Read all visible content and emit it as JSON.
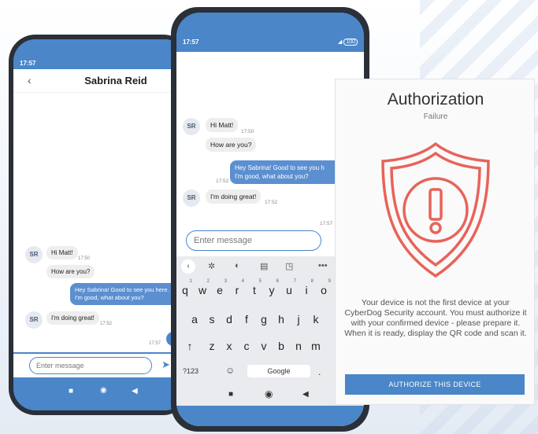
{
  "status": {
    "time": "17:57",
    "battery": "100"
  },
  "chat": {
    "contact_name": "Sabrina Reid",
    "avatar_initials": "SR",
    "messages": {
      "m1": {
        "text": "Hi Matt!",
        "time": "17:50"
      },
      "m2": {
        "text": "How are you?"
      },
      "m3": {
        "line1": "Hey Sabrina! Good to see you here.",
        "line2": "I'm good, what about you?",
        "time": "17:52"
      },
      "m3_mid": {
        "line1": "Hey Sabrina! Good to see you h",
        "line2": "I'm good, what about you?"
      },
      "m4": {
        "text": "I'm doing great!",
        "time": "17:52"
      },
      "m5_time": "17:57"
    },
    "input_placeholder": "Enter message"
  },
  "keyboard": {
    "row1": [
      "q",
      "w",
      "e",
      "r",
      "t",
      "y",
      "u",
      "i",
      "o"
    ],
    "row1_nums": [
      "1",
      "2",
      "3",
      "4",
      "5",
      "6",
      "7",
      "8",
      "9"
    ],
    "row2": [
      "a",
      "s",
      "d",
      "f",
      "g",
      "h",
      "j",
      "k"
    ],
    "row3": [
      "z",
      "x",
      "c",
      "v",
      "b",
      "n",
      "m"
    ],
    "sym_key": "?123",
    "space_label": "Google"
  },
  "auth": {
    "title": "Authorization",
    "subtitle": "Failure",
    "message": "Your device is not the first device at your CyberDog Security account. You must authorize it with your confirmed device - please prepare it. When it is ready, display the QR code and scan it.",
    "button": "AUTHORIZE THIS DEVICE",
    "accent": "#e8635a"
  },
  "colors": {
    "primary": "#4a86c8"
  }
}
